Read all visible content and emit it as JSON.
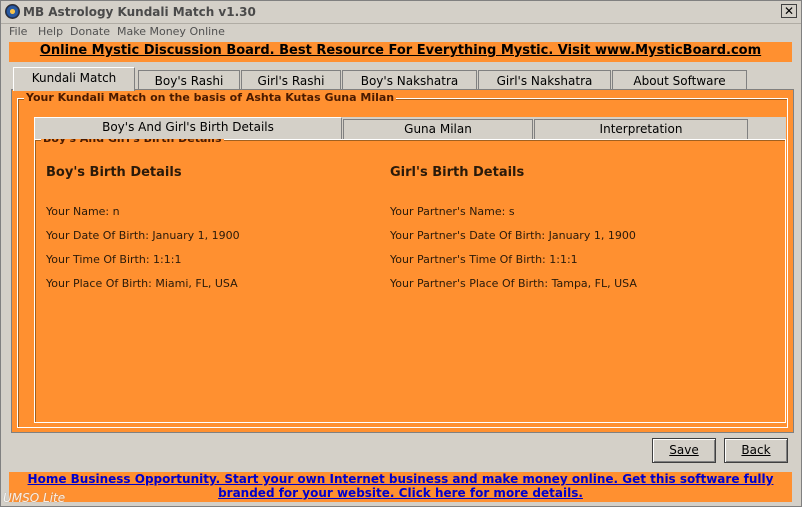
{
  "window": {
    "title": "MB Astrology Kundali Match v1.30",
    "close_glyph": "✕"
  },
  "menu": [
    "File",
    "Help",
    "Donate",
    "Make Money Online"
  ],
  "banner_top": "Online Mystic Discussion Board. Best Resource For Everything Mystic. Visit www.MysticBoard.com",
  "tabs": [
    "Kundali Match",
    "Boy's Rashi",
    "Girl's Rashi",
    "Boy's Nakshatra",
    "Girl's Nakshatra",
    "About Software"
  ],
  "active_tab": "Kundali Match",
  "group_title": "Your Kundali Match on the basis of Ashta Kutas Guna Milan",
  "subtabs": [
    "Boy's And Girl's Birth Details",
    "Guna Milan",
    "Interpretation"
  ],
  "birth_group_title": "Boy's And Girl's Birth Details",
  "boy": {
    "heading": "Boy's Birth Details",
    "name": "Your Name: n",
    "dob": "Your Date Of Birth: January 1, 1900",
    "tob": "Your Time Of Birth: 1:1:1",
    "pob": "Your Place Of Birth: Miami, FL, USA"
  },
  "girl": {
    "heading": "Girl's Birth Details",
    "name": "Your Partner's Name: s",
    "dob": "Your Partner's Date Of Birth: January 1, 1900",
    "tob": "Your Partner's Time Of Birth: 1:1:1",
    "pob": "Your Partner's Place Of Birth: Tampa, FL, USA"
  },
  "buttons": {
    "save": "Save",
    "back": "Back"
  },
  "banner_bottom": "Home Business Opportunity. Start your own Internet business and make money online. Get this software fully branded for your website. Click here for more details.",
  "watermark": "UMSO Lite",
  "colors": {
    "accent": "#ff9030",
    "link": "#0000cc",
    "chrome": "#d4d0c8"
  }
}
